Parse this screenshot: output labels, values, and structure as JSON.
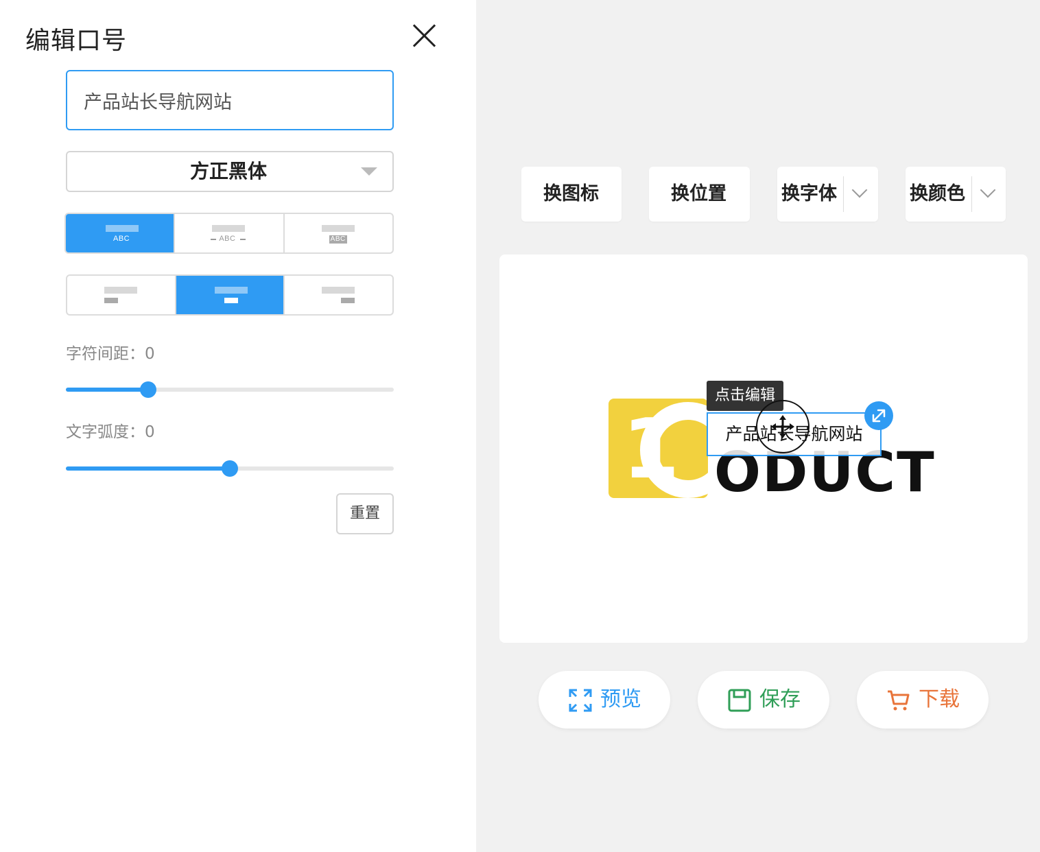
{
  "panel": {
    "title": "编辑口号",
    "slogan_value": "产品站长导航网站",
    "font_name": "方正黑体",
    "layout_options": [
      "ABC",
      "ABC",
      "ABC"
    ],
    "letter_spacing_label": "字符间距：0",
    "letter_spacing_fraction": 0.25,
    "arc_label": "文字弧度：0",
    "arc_fraction": 0.5,
    "reset_label": "重置"
  },
  "toolbar": {
    "change_icon": "换图标",
    "change_position": "换位置",
    "change_font": "换字体",
    "change_color": "换颜色"
  },
  "canvas": {
    "logo_text": "ODUCT",
    "tooltip": "点击编辑",
    "slogan_text": "产品站长导航网站"
  },
  "actions": {
    "preview": "预览",
    "save": "保存",
    "download": "下载"
  },
  "colors": {
    "accent": "#2f9bf3",
    "logo_yellow": "#f2d13e",
    "save_green": "#2f9e57",
    "download_orange": "#e8743a"
  }
}
